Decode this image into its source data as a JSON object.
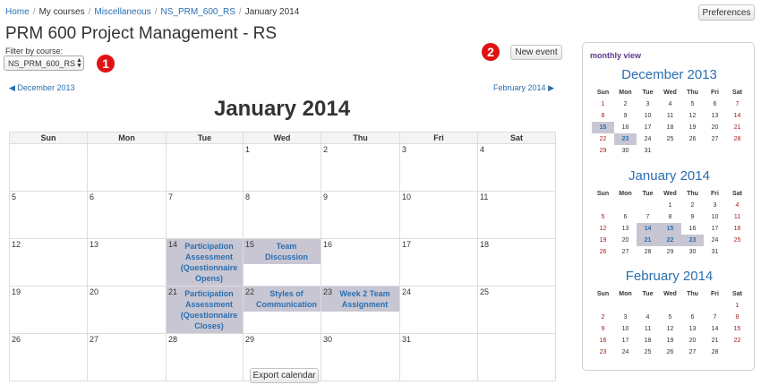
{
  "breadcrumb": [
    "Home",
    "My courses",
    "Miscellaneous",
    "NS_PRM_600_RS",
    "January 2014"
  ],
  "breadcrumb_sep": "/",
  "preferences_label": "Preferences",
  "page_title": "PRM 600 Project Management - RS",
  "filter": {
    "label": "Filter by course:",
    "value": "NS_PRM_600_RS"
  },
  "new_event_label": "New event",
  "markers": [
    "1",
    "2"
  ],
  "nav": {
    "prev": "December 2013",
    "next": "February 2014"
  },
  "month_title": "January 2014",
  "weekdays": [
    "Sun",
    "Mon",
    "Tue",
    "Wed",
    "Thu",
    "Fri",
    "Sat"
  ],
  "weeks": [
    [
      null,
      null,
      null,
      1,
      2,
      3,
      4
    ],
    [
      5,
      6,
      7,
      8,
      9,
      10,
      11
    ],
    [
      12,
      13,
      14,
      15,
      16,
      17,
      18
    ],
    [
      19,
      20,
      21,
      22,
      23,
      24,
      25
    ],
    [
      26,
      27,
      28,
      29,
      30,
      31,
      null
    ]
  ],
  "events": [
    {
      "day": 14,
      "title": "Participation Assessment (Questionnaire Opens)"
    },
    {
      "day": 15,
      "title": "Team Discussion"
    },
    {
      "day": 21,
      "title": "Participation Assessment (Questionnaire Closes)"
    },
    {
      "day": 22,
      "title": "Styles of Communication"
    },
    {
      "day": 23,
      "title": "Week 2 Team Assignment"
    }
  ],
  "export_label": "Export calendar",
  "sidebar": {
    "title": "monthly view",
    "weekdays": [
      "Sun",
      "Mon",
      "Tue",
      "Wed",
      "Thu",
      "Fri",
      "Sat"
    ],
    "months": [
      {
        "title": "December 2013",
        "weeks": [
          [
            1,
            2,
            3,
            4,
            5,
            6,
            7
          ],
          [
            8,
            9,
            10,
            11,
            12,
            13,
            14
          ],
          [
            15,
            16,
            17,
            18,
            19,
            20,
            21
          ],
          [
            22,
            23,
            24,
            25,
            26,
            27,
            28
          ],
          [
            29,
            30,
            31,
            null,
            null,
            null,
            null
          ]
        ],
        "highlight": [
          15,
          23
        ]
      },
      {
        "title": "January 2014",
        "weeks": [
          [
            null,
            null,
            null,
            1,
            2,
            3,
            4
          ],
          [
            5,
            6,
            7,
            8,
            9,
            10,
            11
          ],
          [
            12,
            13,
            14,
            15,
            16,
            17,
            18
          ],
          [
            19,
            20,
            21,
            22,
            23,
            24,
            25
          ],
          [
            26,
            27,
            28,
            29,
            30,
            31,
            null
          ]
        ],
        "highlight": [
          14,
          15,
          21,
          22,
          23
        ]
      },
      {
        "title": "February 2014",
        "weeks": [
          [
            null,
            null,
            null,
            null,
            null,
            null,
            1
          ],
          [
            2,
            3,
            4,
            5,
            6,
            7,
            8
          ],
          [
            9,
            10,
            11,
            12,
            13,
            14,
            15
          ],
          [
            16,
            17,
            18,
            19,
            20,
            21,
            22
          ],
          [
            23,
            24,
            25,
            26,
            27,
            28,
            null
          ]
        ],
        "highlight": []
      }
    ]
  },
  "colors": {
    "link": "#2a6fb0",
    "event_bg": "#c9c6d3",
    "weekend": "#a51d1d",
    "marker": "#e01212",
    "sidebar_title": "#5a3b8a"
  }
}
